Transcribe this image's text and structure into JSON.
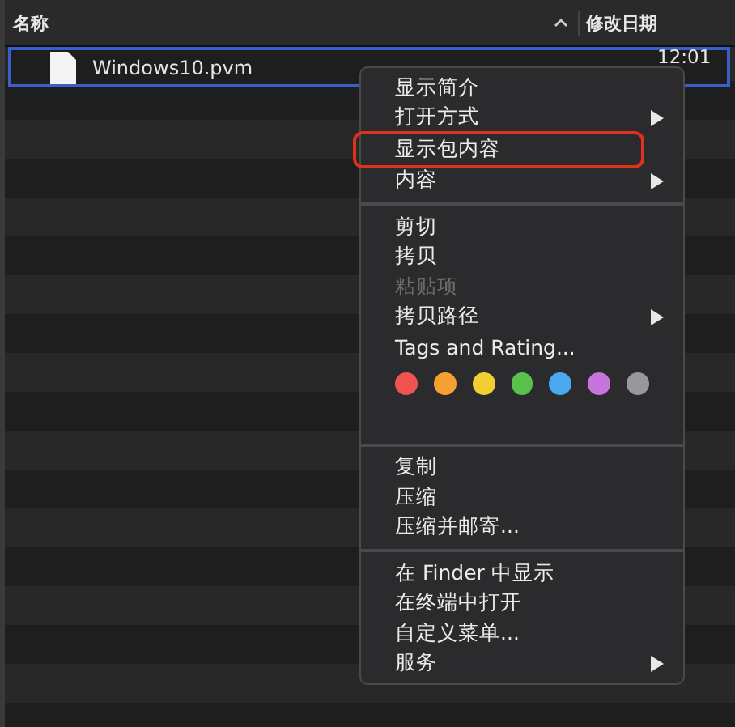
{
  "table": {
    "columns": [
      {
        "label": "名称"
      },
      {
        "label": "修改日期"
      }
    ],
    "rows": [
      {
        "name": "Windows10.pvm",
        "date": "12:01",
        "selected": true
      }
    ]
  },
  "context_menu": {
    "sections": [
      {
        "items": [
          {
            "kind": "item",
            "label": "显示简介",
            "submenu": false,
            "disabled": false,
            "highlighted": false
          },
          {
            "kind": "item",
            "label": "打开方式",
            "submenu": true,
            "disabled": false,
            "highlighted": false
          },
          {
            "kind": "item",
            "label": "显示包内容",
            "submenu": false,
            "disabled": false,
            "highlighted": true
          },
          {
            "kind": "item",
            "label": "内容",
            "submenu": true,
            "disabled": false,
            "highlighted": false
          }
        ]
      },
      {
        "items": [
          {
            "kind": "item",
            "label": "剪切",
            "submenu": false,
            "disabled": false,
            "highlighted": false
          },
          {
            "kind": "item",
            "label": "拷贝",
            "submenu": false,
            "disabled": false,
            "highlighted": false
          },
          {
            "kind": "item",
            "label": "粘贴项",
            "submenu": false,
            "disabled": true,
            "highlighted": false
          },
          {
            "kind": "item",
            "label": "拷贝路径",
            "submenu": true,
            "disabled": false,
            "highlighted": false
          },
          {
            "kind": "item",
            "label": "Tags and Rating...",
            "submenu": false,
            "disabled": false,
            "highlighted": false
          },
          {
            "kind": "tags",
            "tags": [
              {
                "color": "#f05450"
              },
              {
                "color": "#f5a030"
              },
              {
                "color": "#f2cd34"
              },
              {
                "color": "#5ac14a"
              },
              {
                "color": "#4aa8f0"
              },
              {
                "color": "#c774dc"
              },
              {
                "color": "#98989c"
              }
            ]
          }
        ]
      },
      {
        "items": [
          {
            "kind": "item",
            "label": "复制",
            "submenu": false,
            "disabled": false,
            "highlighted": false
          },
          {
            "kind": "item",
            "label": "压缩",
            "submenu": false,
            "disabled": false,
            "highlighted": false
          },
          {
            "kind": "item",
            "label": "压缩并邮寄...",
            "submenu": false,
            "disabled": false,
            "highlighted": false
          }
        ]
      },
      {
        "items": [
          {
            "kind": "item",
            "label": "在 Finder 中显示",
            "submenu": false,
            "disabled": false,
            "highlighted": false
          },
          {
            "kind": "item",
            "label": "在终端中打开",
            "submenu": false,
            "disabled": false,
            "highlighted": false
          },
          {
            "kind": "item",
            "label": "自定义菜单...",
            "submenu": false,
            "disabled": false,
            "highlighted": false
          },
          {
            "kind": "item",
            "label": "服务",
            "submenu": true,
            "disabled": false,
            "highlighted": false
          }
        ]
      }
    ]
  }
}
